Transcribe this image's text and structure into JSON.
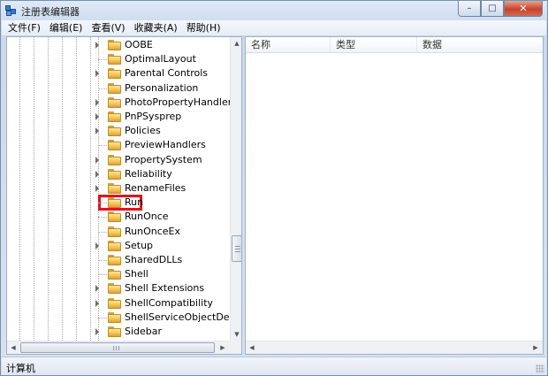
{
  "window": {
    "title": "注册表编辑器",
    "controls": {
      "minimize": "–",
      "maximize": "□",
      "close": "✕"
    }
  },
  "menu": [
    "文件(F)",
    "编辑(E)",
    "查看(V)",
    "收藏夹(A)",
    "帮助(H)"
  ],
  "tree": {
    "items": [
      {
        "label": "OOBE",
        "expandable": true
      },
      {
        "label": "OptimalLayout",
        "expandable": false
      },
      {
        "label": "Parental Controls",
        "expandable": true
      },
      {
        "label": "Personalization",
        "expandable": false
      },
      {
        "label": "PhotoPropertyHandler",
        "expandable": true
      },
      {
        "label": "PnPSysprep",
        "expandable": true
      },
      {
        "label": "Policies",
        "expandable": true
      },
      {
        "label": "PreviewHandlers",
        "expandable": false
      },
      {
        "label": "PropertySystem",
        "expandable": true
      },
      {
        "label": "Reliability",
        "expandable": true
      },
      {
        "label": "RenameFiles",
        "expandable": true
      },
      {
        "label": "Run",
        "expandable": false,
        "highlighted": true
      },
      {
        "label": "RunOnce",
        "expandable": false
      },
      {
        "label": "RunOnceEx",
        "expandable": false
      },
      {
        "label": "Setup",
        "expandable": true
      },
      {
        "label": "SharedDLLs",
        "expandable": false
      },
      {
        "label": "Shell",
        "expandable": false
      },
      {
        "label": "Shell Extensions",
        "expandable": true
      },
      {
        "label": "ShellCompatibility",
        "expandable": true
      },
      {
        "label": "ShellServiceObjectDelayLo",
        "expandable": false
      },
      {
        "label": "Sidebar",
        "expandable": true
      }
    ]
  },
  "list": {
    "columns": [
      "名称",
      "类型",
      "数据"
    ]
  },
  "status": {
    "text": "计算机"
  },
  "icons": {
    "app": "registry-cubes-icon",
    "folder": "folder-icon",
    "expander": "triangle-right-icon"
  },
  "colors": {
    "highlight_box": "#e0141e",
    "folder": "#f2c14e",
    "close_button": "#c7432a"
  }
}
